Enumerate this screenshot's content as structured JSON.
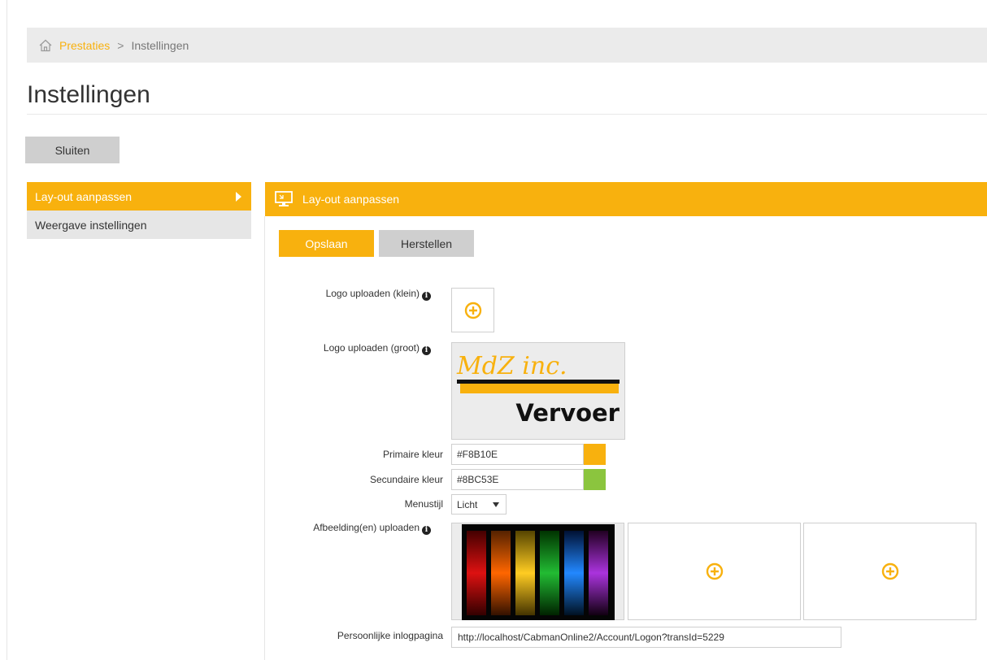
{
  "breadcrumb": {
    "home_icon": "home-icon",
    "link": "Prestaties",
    "separator": ">",
    "current": "Instellingen"
  },
  "page": {
    "title": "Instellingen"
  },
  "actions": {
    "close_label": "Sluiten"
  },
  "sidemenu": {
    "items": [
      {
        "label": "Lay-out aanpassen",
        "active": true
      },
      {
        "label": "Weergave instellingen",
        "active": false
      }
    ]
  },
  "panel": {
    "title": "Lay-out aanpassen",
    "icon": "monitor-icon",
    "save_label": "Opslaan",
    "reset_label": "Herstellen"
  },
  "form": {
    "logo_small_label": "Logo uploaden (klein)",
    "logo_big_label": "Logo uploaden (groot)",
    "logo_big_text_top": "MdZ inc.",
    "logo_big_text_bottom": "Vervoer",
    "primary_color_label": "Primaire kleur",
    "primary_color_value": "#F8B10E",
    "secondary_color_label": "Secundaire kleur",
    "secondary_color_value": "#8BC53E",
    "menu_style_label": "Menustijl",
    "menu_style_value": "Licht",
    "images_label": "Afbeelding(en) uploaden",
    "login_page_label": "Persoonlijke inlogpagina",
    "login_page_value": "http://localhost/CabmanOnline2/Account/Logon?transId=5229"
  },
  "colors": {
    "accent": "#f8b10e",
    "secondary": "#8bc53e",
    "inactive": "#cfcfcf"
  }
}
